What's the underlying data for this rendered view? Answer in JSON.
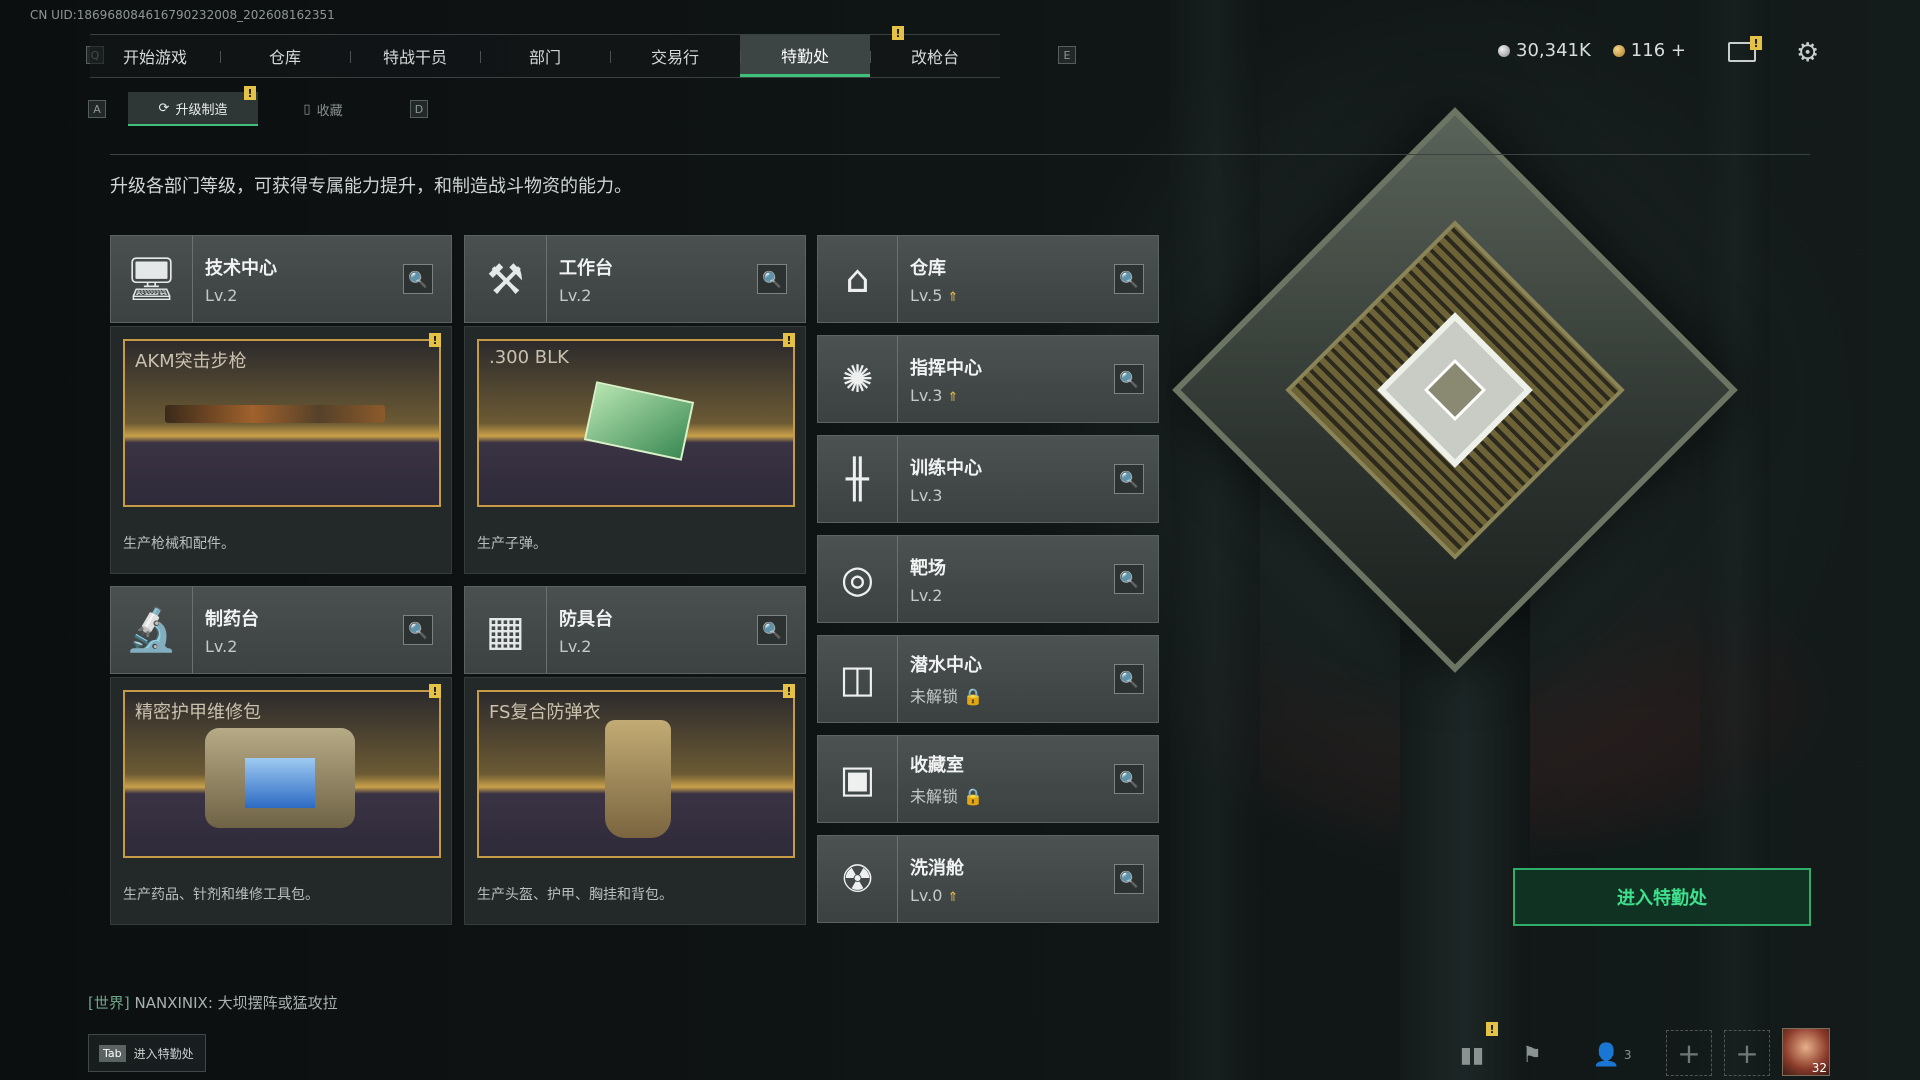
{
  "uid": "CN UID:1869680846167902320​08_202608162351",
  "nav": {
    "key_left": "Q",
    "key_right": "E",
    "tabs": [
      {
        "label": "开始游戏"
      },
      {
        "label": "仓库"
      },
      {
        "label": "特战干员"
      },
      {
        "label": "部门"
      },
      {
        "label": "交易行"
      },
      {
        "label": "特勤处"
      },
      {
        "label": "改枪台"
      }
    ],
    "active_tab": "特勤处"
  },
  "currency": {
    "silver": "30,341K",
    "gold": "116",
    "gold_add": "+"
  },
  "subtabs": {
    "key_left": "A",
    "key_right": "D",
    "items": [
      {
        "label": "升级制造",
        "icon": "upgrade-icon"
      },
      {
        "label": "收藏",
        "icon": "collection-icon"
      }
    ]
  },
  "intro": "升级各部门等级，可获得专属能力提升，和制造战斗物资的能力。",
  "facilities": [
    {
      "name": "技术中心",
      "level": "Lv.2",
      "icon": "computer-icon",
      "product": "AKM突击步枪",
      "desc": "生产枪械和配件。"
    },
    {
      "name": "工作台",
      "level": "Lv.2",
      "icon": "tools-icon",
      "product": ".300 BLK",
      "desc": "生产子弹。"
    },
    {
      "name": "制药台",
      "level": "Lv.2",
      "icon": "microscope-icon",
      "product": "精密护甲维修包",
      "desc": "生产药品、针剂和维修工具包。"
    },
    {
      "name": "防具台",
      "level": "Lv.2",
      "icon": "boxes-icon",
      "product": "FS复合防弹衣",
      "desc": "生产头盔、护甲、胸挂和背包。"
    }
  ],
  "side_facilities": [
    {
      "name": "仓库",
      "level": "Lv.5",
      "icon": "warehouse-icon",
      "upgradable": true
    },
    {
      "name": "指挥中心",
      "level": "Lv.3",
      "icon": "command-icon",
      "upgradable": true
    },
    {
      "name": "训练中心",
      "level": "Lv.3",
      "icon": "dumbbell-icon",
      "upgradable": false
    },
    {
      "name": "靶场",
      "level": "Lv.2",
      "icon": "target-icon",
      "upgradable": false
    },
    {
      "name": "潜水中心",
      "level": "未解锁",
      "icon": "diving-mask-icon",
      "locked": true
    },
    {
      "name": "收藏室",
      "level": "未解锁",
      "icon": "collection-room-icon",
      "locked": true
    },
    {
      "name": "洗消舱",
      "level": "Lv.0",
      "icon": "hazmat-icon",
      "upgradable": true
    }
  ],
  "enter_button": "进入特勤处",
  "chat": {
    "channel": "[世界]",
    "user": "NANXINIX:",
    "message": "大坝摆阵或猛攻拉"
  },
  "tab_hint": {
    "key": "Tab",
    "label": "进入特勤处"
  },
  "bottom": {
    "friends_count": "3",
    "avatar_level": "32"
  }
}
